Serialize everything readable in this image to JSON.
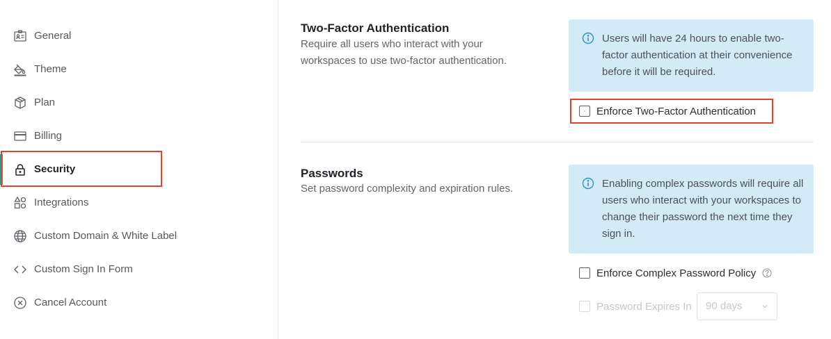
{
  "sidebar": {
    "items": [
      {
        "label": "General",
        "icon": "id-card-icon"
      },
      {
        "label": "Theme",
        "icon": "paint-bucket-icon"
      },
      {
        "label": "Plan",
        "icon": "package-icon"
      },
      {
        "label": "Billing",
        "icon": "credit-card-icon"
      },
      {
        "label": "Security",
        "icon": "lock-icon",
        "active": true
      },
      {
        "label": "Integrations",
        "icon": "shapes-icon"
      },
      {
        "label": "Custom Domain & White Label",
        "icon": "globe-icon"
      },
      {
        "label": "Custom Sign In Form",
        "icon": "code-icon"
      },
      {
        "label": "Cancel Account",
        "icon": "x-circle-icon"
      }
    ]
  },
  "two_factor": {
    "title": "Two-Factor Authentication",
    "description": "Require all users who interact with your workspaces to use two-factor authentication.",
    "info": "Users will have 24 hours to enable two-factor authentication at their convenience before it will be required.",
    "checkbox_label": "Enforce Two-Factor Authentication",
    "checked": false
  },
  "passwords": {
    "title": "Passwords",
    "description": "Set password complexity and expiration rules.",
    "info": "Enabling complex passwords will require all users who interact with your workspaces to change their password the next time they sign in.",
    "complex_label": "Enforce Complex Password Policy",
    "complex_checked": false,
    "expires_label": "Password Expires In",
    "expires_checked": false,
    "expires_value": "90 days"
  },
  "colors": {
    "accent": "#2aa595",
    "info_bg": "#d3ebf7",
    "highlight": "#e2432a"
  }
}
